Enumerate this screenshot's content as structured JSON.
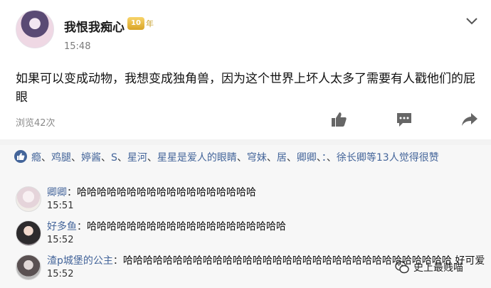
{
  "post": {
    "username": "我恨我痴心",
    "badge_text": "年",
    "badge_level": "10",
    "time": "15:48",
    "content": "如果可以变成动物，我想变成独角兽，因为这个世界上坏人太多了需要有人戳他们的屁眼",
    "views": "浏览42次"
  },
  "likes": {
    "names": [
      "瘾",
      "、",
      "鸡腿",
      "、",
      "婷酱",
      "、",
      "S",
      "、",
      "星河",
      "、",
      "星星是爱人的眼睛",
      "、",
      "穹妹",
      "、",
      "居",
      "、",
      "卿卿",
      "、",
      "：",
      "、",
      "徐长卿"
    ],
    "summary": "等13人觉得很赞"
  },
  "comments": [
    {
      "name": "卿卿",
      "separator": "：",
      "text": "哈哈哈哈哈哈哈哈哈哈哈哈哈哈哈哈哈哈",
      "time": "15:51"
    },
    {
      "name": "好多鱼",
      "separator": "：",
      "text": "哈哈哈哈哈哈哈哈哈哈哈哈哈哈哈哈哈哈哈哈",
      "time": "15:52"
    },
    {
      "name": "渣p城堡的公主",
      "separator": "：",
      "text": "哈哈哈哈哈哈哈哈哈哈哈哈哈哈哈哈哈哈哈哈哈哈哈哈哈哈哈哈哈哈哈哈哈 好可爱",
      "time": "15:52"
    }
  ],
  "watermark": {
    "text": "史上最贱喵"
  },
  "colors": {
    "link": "#44659a",
    "meta": "#7b7b7b",
    "panel": "#f7f7f7"
  },
  "icons": [
    "chevron-down-icon",
    "like-icon",
    "comment-icon",
    "share-icon",
    "thumbs-up-icon",
    "wechat-icon"
  ]
}
